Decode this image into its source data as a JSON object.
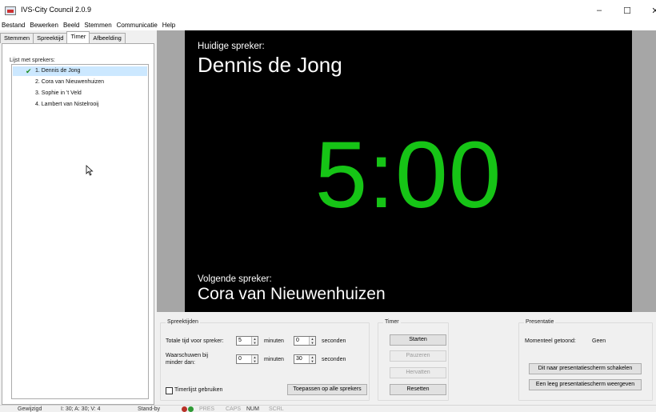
{
  "window": {
    "title": "IVS-City Council 2.0.9",
    "buttons": {
      "minimize": "–",
      "maximize": "☐",
      "close": "✕"
    }
  },
  "menu": [
    "Bestand",
    "Bewerken",
    "Beeld",
    "Stemmen",
    "Communicatie",
    "Help"
  ],
  "tabs": [
    {
      "label": "Stemmen",
      "active": false
    },
    {
      "label": "Spreektijd",
      "active": false
    },
    {
      "label": "Timer",
      "active": true
    },
    {
      "label": "Afbeelding",
      "active": false
    }
  ],
  "speakers": {
    "label": "Lijst met sprekers:",
    "items": [
      "1. Dennis de Jong",
      "2. Cora van Nieuwenhuizen",
      "3. Sophie in 't Veld",
      "4. Lambert van Nistelrooij"
    ],
    "selected_index": 0
  },
  "preview": {
    "current_label": "Huidige spreker:",
    "current_name": "Dennis de Jong",
    "timer": "5:00",
    "next_label": "Volgende spreker:",
    "next_name": "Cora van Nieuwenhuizen",
    "timer_color": "#16c416"
  },
  "speaking_times": {
    "title": "Spreektijden",
    "total_label": "Totale tijd voor spreker:",
    "total_minutes": "5",
    "total_seconds": "0",
    "warn_label_1": "Waarschuwen bij",
    "warn_label_2": "minder dan:",
    "warn_minutes": "0",
    "warn_seconds": "30",
    "minutes_label": "minuten",
    "seconds_label": "seconden",
    "use_timerlist_label": "Timerlijst gebruiken",
    "use_timerlist_checked": false,
    "apply_button": "Toepassen op alle sprekers"
  },
  "timer": {
    "title": "Timer",
    "start": "Starten",
    "pause": "Pauzeren",
    "resume": "Hervatten",
    "reset": "Resetten"
  },
  "presentation": {
    "title": "Presentatie",
    "current_shown_label": "Momenteel getoond:",
    "current_shown_value": "Geen",
    "switch_button": "Dit naar presentatiescherm schakelen",
    "empty_button": "Een leeg presentatiescherm weergeven"
  },
  "status": {
    "modified": "Gewijzigd",
    "counts": "I: 30;  A: 30;  V: 4",
    "mode": "Stand-by",
    "indicators": [
      "PRES",
      "CAPS",
      "NUM",
      "SCRL"
    ],
    "active_indicator": "NUM"
  }
}
